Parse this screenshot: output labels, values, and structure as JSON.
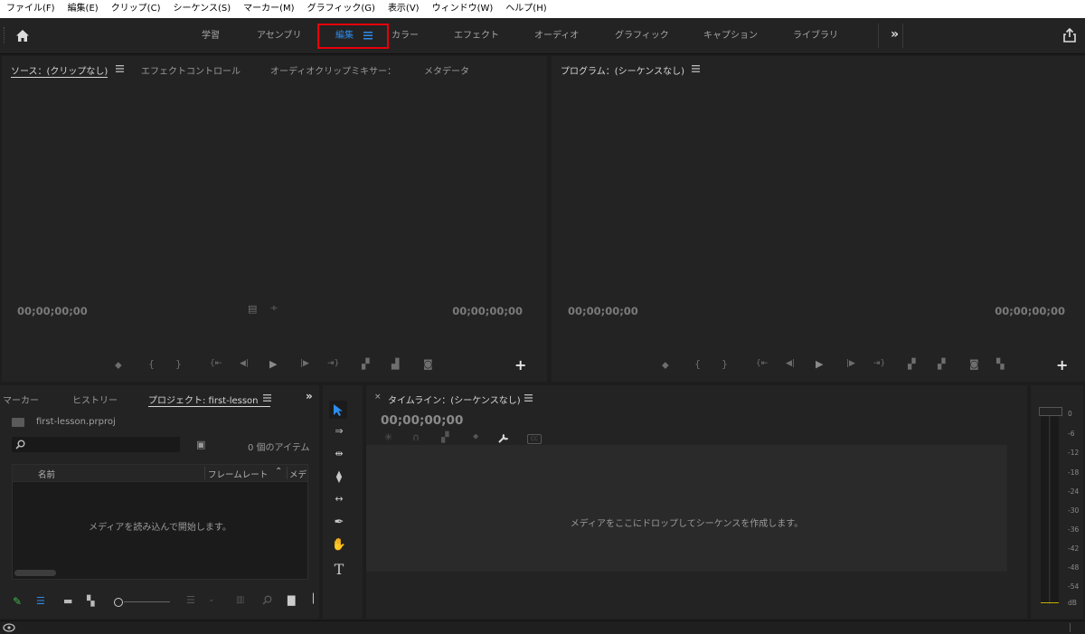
{
  "menu": [
    "ファイル(F)",
    "編集(E)",
    "クリップ(C)",
    "シーケンス(S)",
    "マーカー(M)",
    "グラフィック(G)",
    "表示(V)",
    "ウィンドウ(W)",
    "ヘルプ(H)"
  ],
  "workspace_tabs": [
    "学習",
    "アセンブリ",
    "編集",
    "カラー",
    "エフェクト",
    "オーディオ",
    "グラフィック",
    "キャプション",
    "ライブラリ"
  ],
  "active_workspace": "編集",
  "colors": {
    "accent": "#2d8ceb",
    "highlight_box": "#e8000b",
    "panel_bg": "#232323",
    "app_bg": "#1d1d1d"
  },
  "source_panel": {
    "tabs": [
      "ソース：(クリップなし)",
      "エフェクトコントロール",
      "オーディオクリップミキサー：",
      "メタデータ"
    ],
    "timecode_left": "00;00;00;00",
    "timecode_right": "00;00;00;00"
  },
  "program_panel": {
    "title": "プログラム：(シーケンスなし)",
    "timecode_left": "00;00;00;00",
    "timecode_right": "00;00;00;00"
  },
  "project_panel": {
    "tabs": [
      "マーカー",
      "ヒストリー",
      "プロジェクト: first-lesson"
    ],
    "file_name": "first-lesson.prproj",
    "item_count": "0 個のアイテム",
    "columns": [
      "名前",
      "フレームレート",
      "メデ"
    ],
    "empty_message": "メディアを読み込んで開始します。",
    "search_value": ""
  },
  "timeline_panel": {
    "title": "タイムライン：(シーケンスなし)",
    "timecode": "00;00;00;00",
    "empty_message": "メディアをここにドロップしてシーケンスを作成します。"
  },
  "audio_meter": {
    "labels": [
      "0",
      "-6",
      "-12",
      "-18",
      "-24",
      "-30",
      "-36",
      "-42",
      "-48",
      "-54",
      "dB"
    ]
  },
  "icons": [
    "home-icon",
    "overflow-chevron-icon",
    "share-icon",
    "panel-menu-icon",
    "search-icon",
    "new-bin-icon",
    "selection-tool-icon",
    "track-select-tool-icon",
    "ripple-edit-tool-icon",
    "razor-tool-icon",
    "slip-tool-icon",
    "pen-tool-icon",
    "hand-tool-icon",
    "type-tool-icon",
    "add-button-icon",
    "play-icon",
    "camera-icon",
    "wrench-icon",
    "cc-icon",
    "creative-cloud-icon"
  ]
}
